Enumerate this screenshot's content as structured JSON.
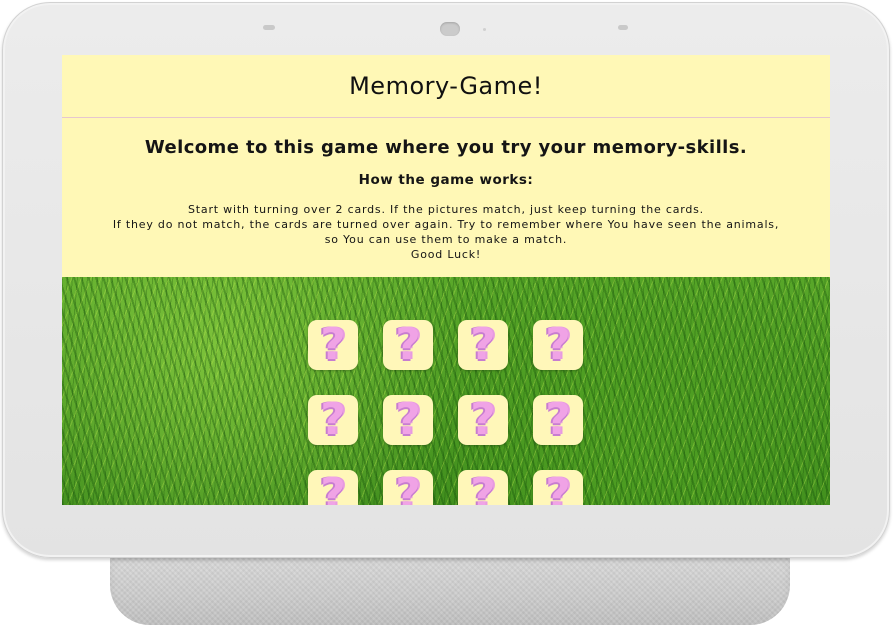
{
  "header": {
    "title": "Memory-Game!"
  },
  "intro": {
    "welcome": "Welcome to this game where you try your memory-skills.",
    "how_heading": "How the game works:",
    "lines": [
      "Start with turning over 2 cards. If the pictures match, just keep turning the cards.",
      "If they do not match, the cards are turned over again. Try to remember where You have seen the animals,",
      "so You can use them to make a match.",
      "Good Luck!"
    ]
  },
  "board": {
    "card_face_symbol": "?",
    "card_icon": "question-mark-icon",
    "visible_cards": 12,
    "columns": 4
  },
  "colors": {
    "panel_bg": "#fff8b6",
    "card_bg": "#fff7b9",
    "question_mark": "#f0a3e6",
    "board_grass": "#4f9f22"
  }
}
